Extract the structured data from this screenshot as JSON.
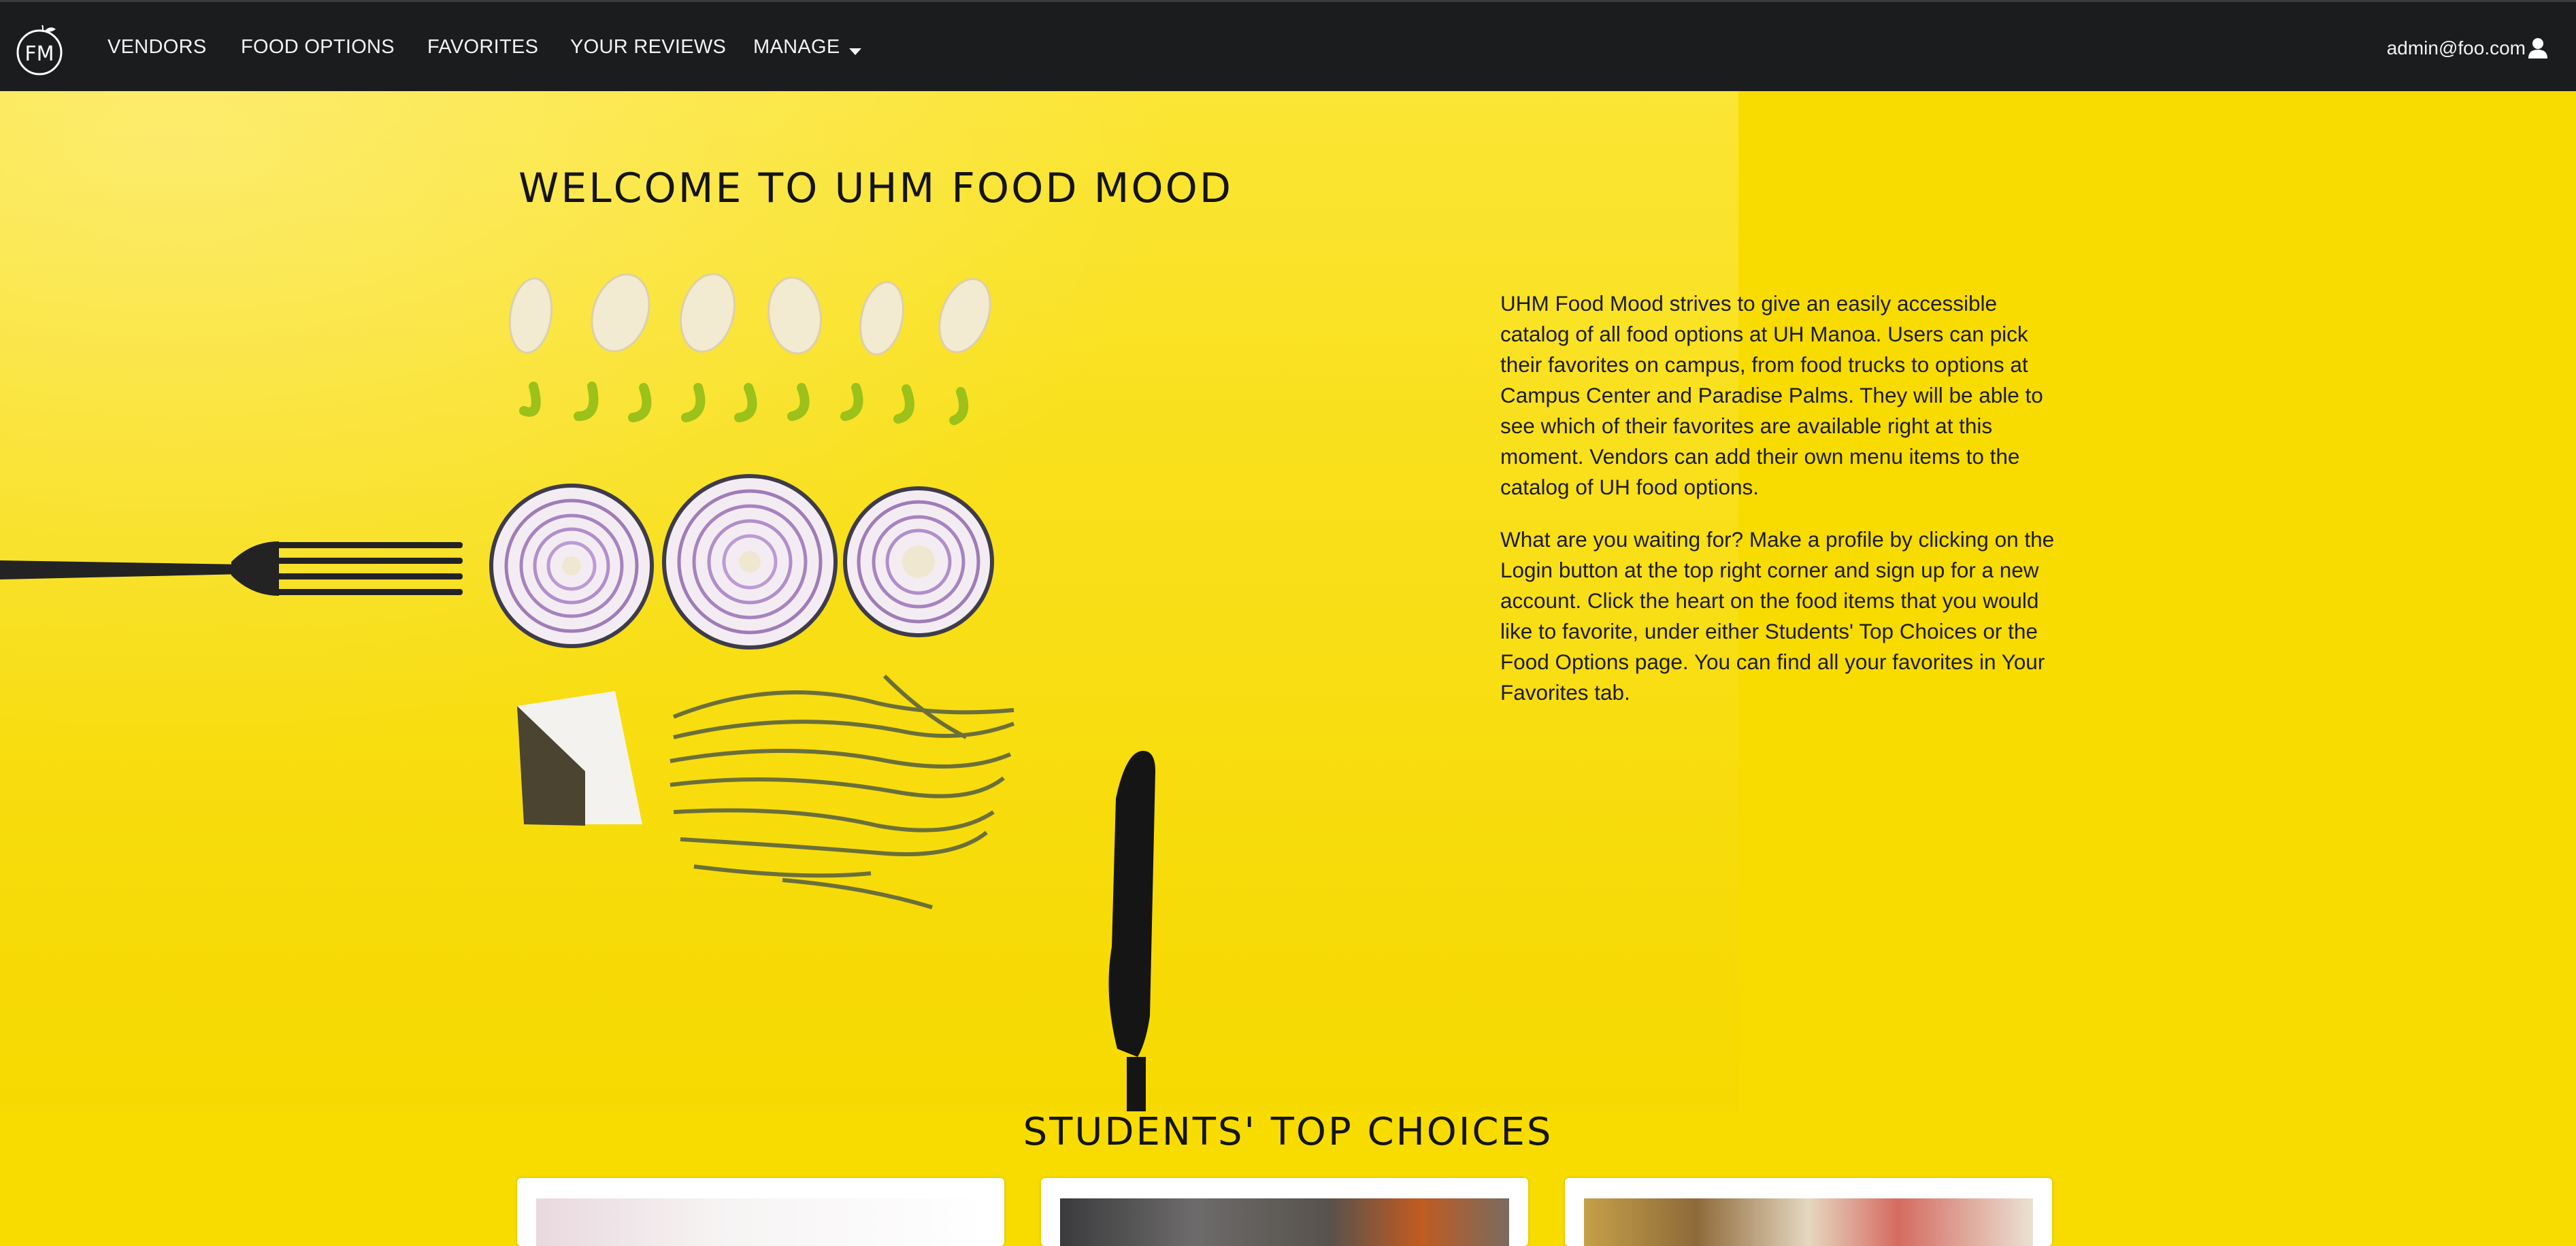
{
  "navbar": {
    "logo_text": "FM",
    "items": [
      {
        "label": "VENDORS"
      },
      {
        "label": "FOOD OPTIONS"
      },
      {
        "label": "FAVORITES"
      },
      {
        "label": "YOUR REVIEWS"
      },
      {
        "label": "MANAGE"
      }
    ],
    "user_email": "admin@foo.com"
  },
  "hero": {
    "title": "WELCOME TO UHM FOOD MOOD",
    "paragraphs": [
      "UHM Food Mood strives to give an easily accessible catalog of all food options at UH Manoa. Users can pick their favorites on campus, from food trucks to options at Campus Center and Paradise Palms. They will be able to see which of their favorites are available right at this moment. Vendors can add their own menu items to the catalog of UH food options.",
      "What are you waiting for? Make a profile by clicking on the Login button at the top right corner and sign up for a new account. Click the heart on the food items that you would like to favorite, under either Students' Top Choices or the Food Options page. You can find all your favorites in Your Favorites tab."
    ]
  },
  "top_choices": {
    "title": "STUDENTS' TOP CHOICES"
  },
  "colors": {
    "navbar_bg": "#1b1c1e",
    "hero_yellow": "#f8dc00",
    "text_dark": "#141414"
  },
  "icons": [
    "fm-logo-icon",
    "caret-down-icon",
    "user-icon",
    "fork-icon",
    "knife-icon"
  ]
}
